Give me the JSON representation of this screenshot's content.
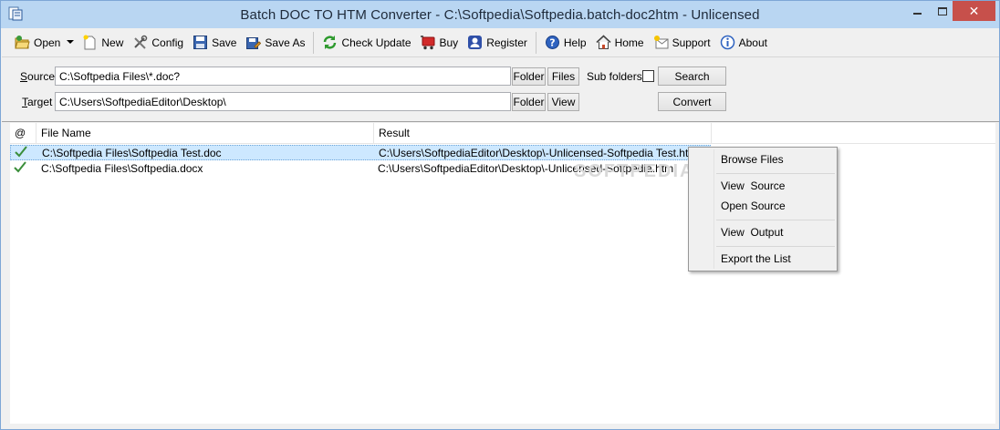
{
  "window": {
    "title": "Batch DOC TO HTM Converter - C:\\Softpedia\\Softpedia.batch-doc2htm - Unlicensed",
    "minimize_icon": "minimize-icon",
    "maximize_icon": "maximize-icon",
    "close_label": "✕"
  },
  "toolbar": {
    "open": "Open",
    "new": "New",
    "config": "Config",
    "save": "Save",
    "save_as": "Save As",
    "check_update": "Check Update",
    "buy": "Buy",
    "register": "Register",
    "help": "Help",
    "home": "Home",
    "support": "Support",
    "about": "About"
  },
  "paths": {
    "source_label_accel": "S",
    "source_label_rest": "ource",
    "source_value": "C:\\Softpedia Files\\*.doc?",
    "target_label_accel": "T",
    "target_label_rest": "arget",
    "target_value": "C:\\Users\\SoftpediaEditor\\Desktop\\",
    "folder_btn": "Folder",
    "files_btn": "Files",
    "view_btn": "View",
    "subfolders_label": "Sub folders",
    "subfolders_checked": false,
    "search_btn": "Search",
    "convert_btn": "Convert"
  },
  "list": {
    "columns": [
      "@",
      "File Name",
      "Result"
    ],
    "rows": [
      {
        "status": "done",
        "file": "C:\\Softpedia Files\\Softpedia Test.doc",
        "result": "C:\\Users\\SoftpediaEditor\\Desktop\\-Unlicensed-Softpedia Test.htm"
      },
      {
        "status": "done",
        "file": "C:\\Softpedia Files\\Softpedia.docx",
        "result": "C:\\Users\\SoftpediaEditor\\Desktop\\-Unlicensed-Softpedia.htm"
      }
    ]
  },
  "watermark": "SOFTPEDIA",
  "context_menu": {
    "browse_files": "Browse Files",
    "view_source": "View  Source",
    "open_source": "Open Source",
    "view_output": "View  Output",
    "export_list": "Export the List"
  },
  "colors": {
    "titlebar": "#b9d6f2",
    "close": "#c7504b",
    "selection": "#cde8ff",
    "check": "#3a8e3a"
  }
}
